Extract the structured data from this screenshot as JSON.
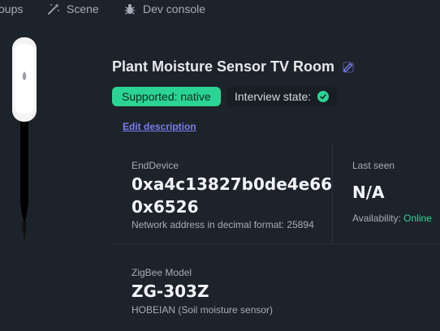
{
  "nav": {
    "groups_label": "oups",
    "scene_label": "Scene",
    "dev_console_label": "Dev console"
  },
  "device": {
    "title": "Plant Moisture Sensor TV Room",
    "supported_badge": "Supported: native",
    "interview_label": "Interview state:",
    "edit_description_link": "Edit description"
  },
  "stats": {
    "end_device": {
      "label": "EndDevice",
      "ieee_address": "0xa4c13827b0de4e66",
      "network_address": "0x6526",
      "description": "Network address in decimal format: 25894"
    },
    "last_seen": {
      "label": "Last seen",
      "value": "N/A",
      "availability_label": "Availability:",
      "availability_value": "Online"
    },
    "zigbee_model": {
      "label": "ZigBee Model",
      "value": "ZG-303Z",
      "description": "HOBEIAN (Soil moisture sensor)"
    }
  },
  "colors": {
    "background": "#1d232a",
    "success": "#2bd494",
    "link": "#7b7ef0"
  }
}
